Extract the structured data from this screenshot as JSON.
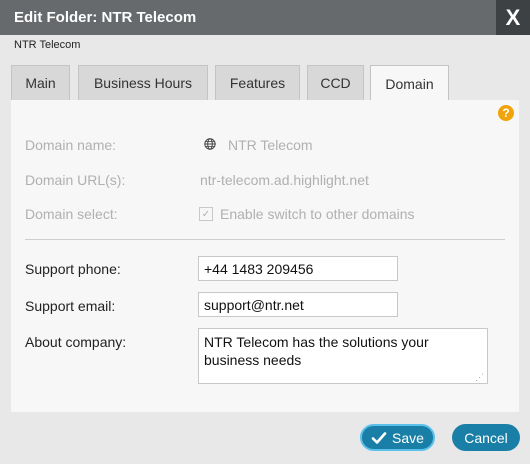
{
  "dialog": {
    "title": "Edit Folder: NTR Telecom",
    "close_glyph": "X",
    "subtitle": "NTR Telecom"
  },
  "tabs": [
    {
      "label": "Main",
      "active": false
    },
    {
      "label": "Business Hours",
      "active": false
    },
    {
      "label": "Features",
      "active": false
    },
    {
      "label": "CCD",
      "active": false
    },
    {
      "label": "Domain",
      "active": true
    }
  ],
  "help_glyph": "?",
  "domain": {
    "name_label": "Domain name:",
    "name_value": "NTR Telecom",
    "url_label": "Domain URL(s):",
    "url_value": "ntr-telecom.ad.highlight.net",
    "select_label": "Domain select:",
    "select_checkbox_label": "Enable switch to other domains",
    "select_checked": true
  },
  "support": {
    "phone_label": "Support phone:",
    "phone_value": "+44 1483 209456",
    "email_label": "Support email:",
    "email_value": "support@ntr.net",
    "about_label": "About company:",
    "about_value": "NTR Telecom has the solutions your business needs"
  },
  "buttons": {
    "save_label": "Save",
    "cancel_label": "Cancel"
  },
  "colors": {
    "titlebar": "#666a6d",
    "accent_button": "#1a7fa6",
    "help_icon": "#f0a30a"
  }
}
